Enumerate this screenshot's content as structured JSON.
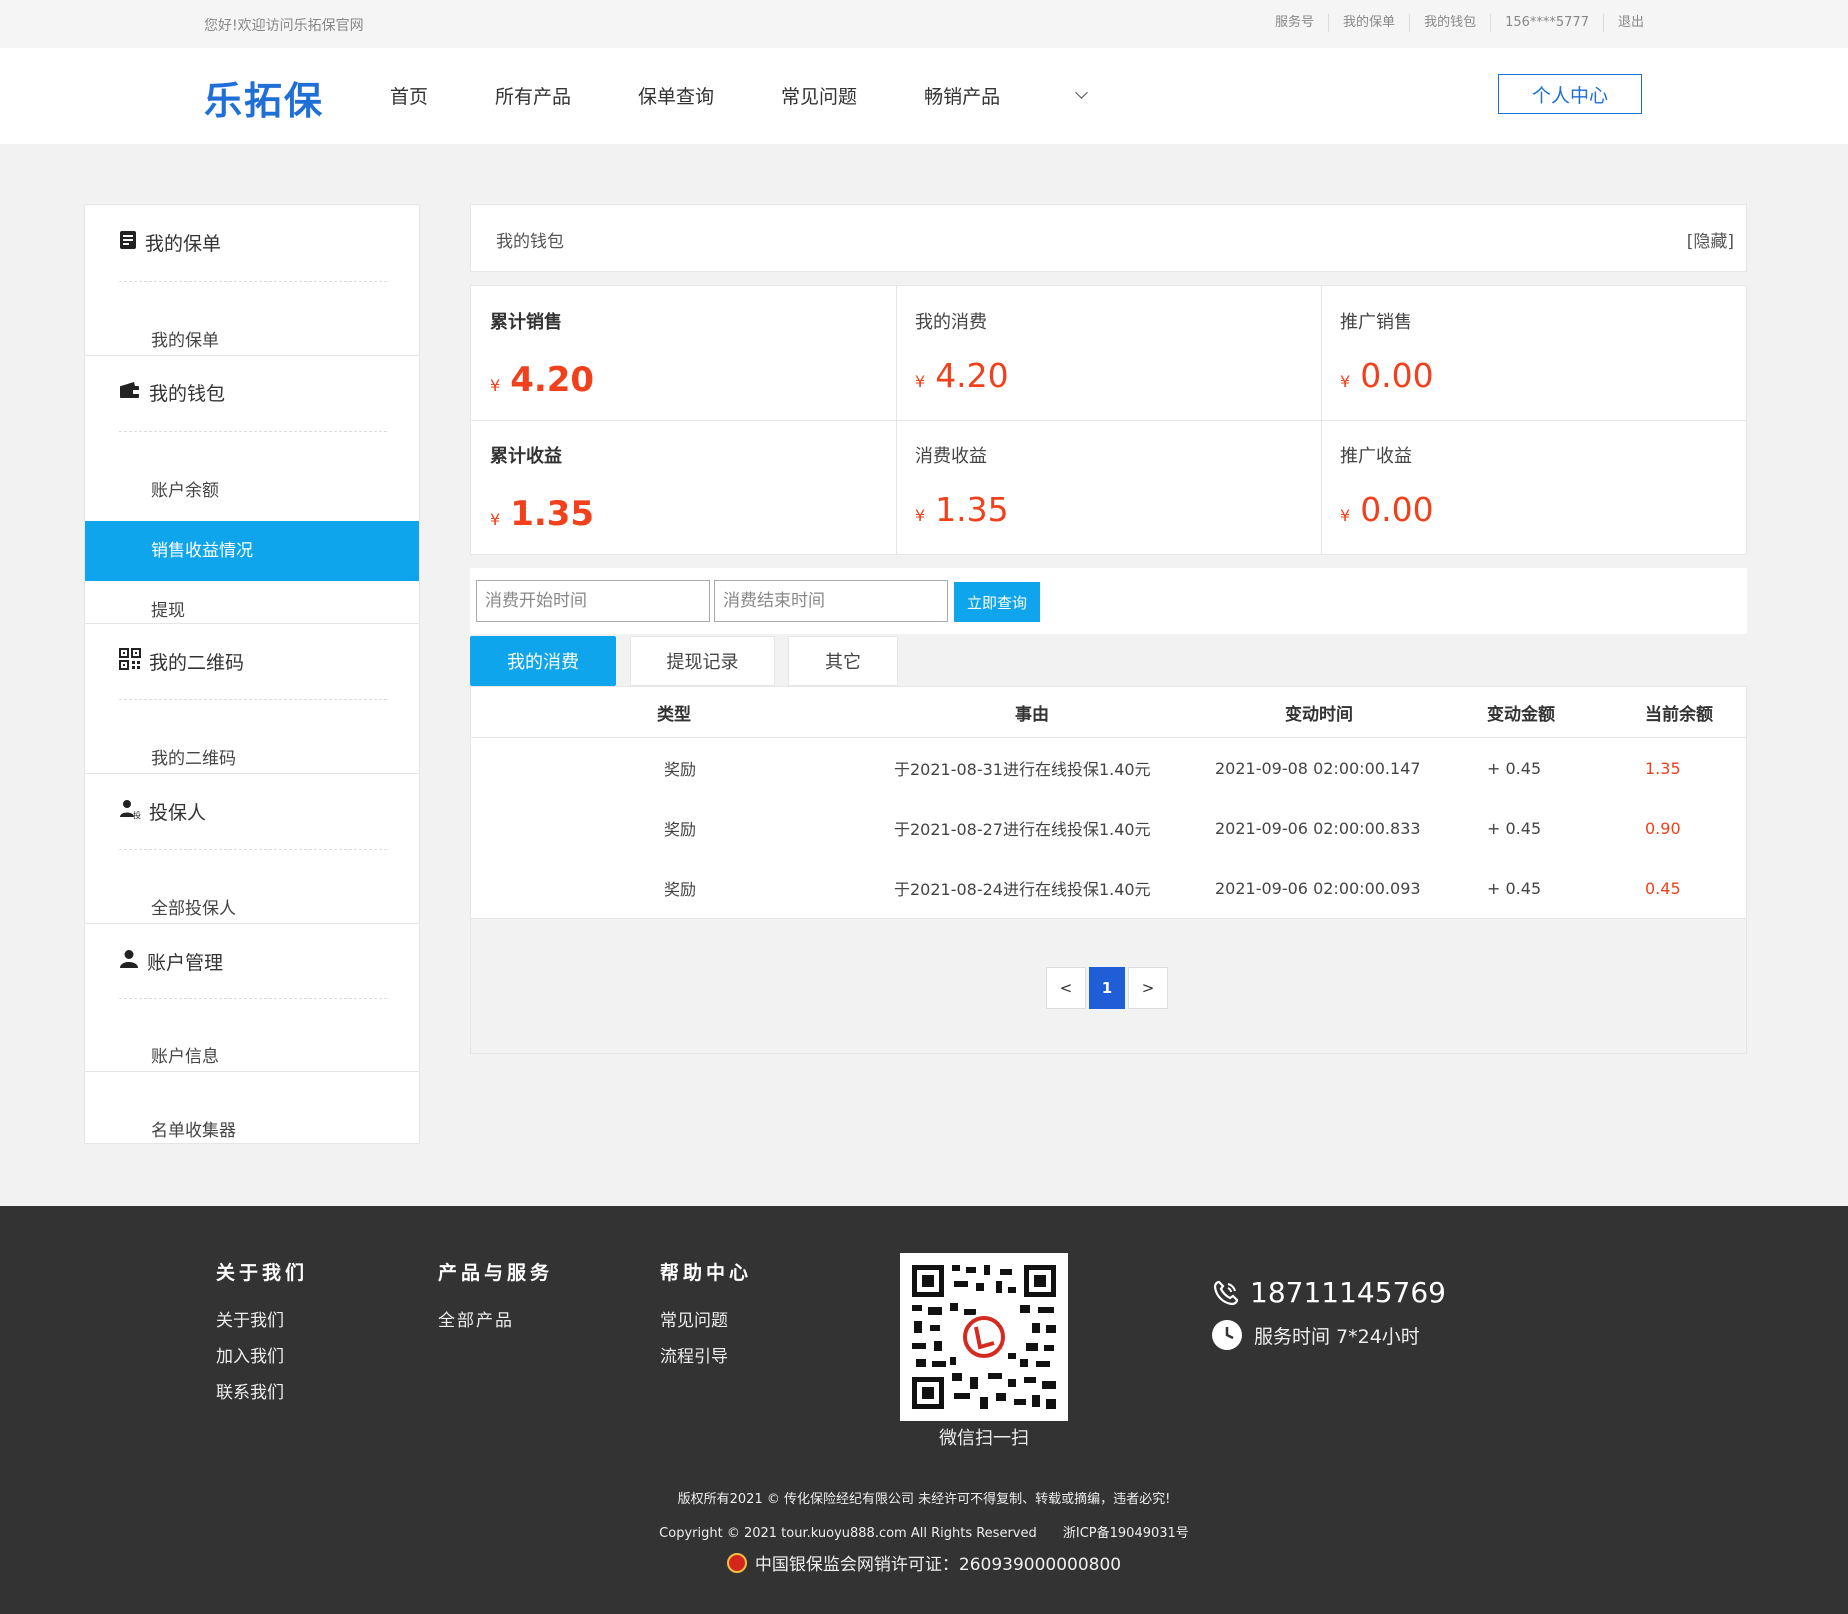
{
  "topbar": {
    "greeting": "您好!欢迎访问乐拓保官网",
    "links": [
      "服务号",
      "我的保单",
      "我的钱包",
      "156****5777",
      "退出"
    ]
  },
  "header": {
    "logo": "乐拓保",
    "nav": [
      "首页",
      "所有产品",
      "保单查询",
      "常见问题",
      "畅销产品"
    ],
    "personal_center": "个人中心"
  },
  "sidebar": {
    "sections": [
      {
        "title": "我的保单",
        "icon": "policy-icon",
        "items": [
          "我的保单"
        ]
      },
      {
        "title": "我的钱包",
        "icon": "wallet-icon",
        "items": [
          "账户余额",
          "销售收益情况",
          "提现"
        ]
      },
      {
        "title": "我的二维码",
        "icon": "qrcode-icon",
        "items": [
          "我的二维码"
        ]
      },
      {
        "title": "投保人",
        "icon": "insured-user-icon",
        "items": [
          "全部投保人"
        ]
      },
      {
        "title": "账户管理",
        "icon": "user-icon",
        "items": [
          "账户信息"
        ]
      }
    ],
    "extra_item": "名单收集器",
    "active_item": "销售收益情况"
  },
  "wallet": {
    "title": "我的钱包",
    "hide_label": "[隐藏]"
  },
  "stats": {
    "currency": "¥",
    "cells": [
      {
        "label": "累计销售",
        "value": "4.20"
      },
      {
        "label": "我的消费",
        "value": "4.20"
      },
      {
        "label": "推广销售",
        "value": "0.00"
      },
      {
        "label": "累计收益",
        "value": "1.35"
      },
      {
        "label": "消费收益",
        "value": "1.35"
      },
      {
        "label": "推广收益",
        "value": "0.00"
      }
    ]
  },
  "filter": {
    "start_placeholder": "消费开始时间",
    "end_placeholder": "消费结束时间",
    "query_button": "立即查询"
  },
  "tabs": [
    "我的消费",
    "提现记录",
    "其它"
  ],
  "table": {
    "headers": [
      "类型",
      "事由",
      "变动时间",
      "变动金额",
      "当前余额"
    ],
    "rows": [
      {
        "type": "奖励",
        "reason": "于2021-08-31进行在线投保1.40元",
        "time": "2021-09-08 02:00:00.147",
        "amount": "+ 0.45",
        "balance": "1.35"
      },
      {
        "type": "奖励",
        "reason": "于2021-08-27进行在线投保1.40元",
        "time": "2021-09-06 02:00:00.833",
        "amount": "+ 0.45",
        "balance": "0.90"
      },
      {
        "type": "奖励",
        "reason": "于2021-08-24进行在线投保1.40元",
        "time": "2021-09-06 02:00:00.093",
        "amount": "+ 0.45",
        "balance": "0.45"
      }
    ]
  },
  "pager": {
    "prev": "<",
    "current": "1",
    "next": ">"
  },
  "footer": {
    "cols": [
      {
        "title": "关于我们",
        "links": [
          "关于我们",
          "加入我们",
          "联系我们"
        ]
      },
      {
        "title": "产品与服务",
        "links": [
          "全部产品"
        ]
      },
      {
        "title": "帮助中心",
        "links": [
          "常见问题",
          "流程引导"
        ]
      }
    ],
    "qr_caption": "微信扫一扫",
    "phone": "18711145769",
    "service_time": "服务时间 7*24小时",
    "copyright": "版权所有2021 © 传化保险经纪有限公司 未经许可不得复制、转载或摘编，违者必究!",
    "copyright_en": "Copyright © 2021 tour.kuoyu888.com All Rights Reserved",
    "icp": "浙ICP备19049031号",
    "license": "中国银保监会网销许可证：260939000000800"
  },
  "colors": {
    "brand": "#1f6fd6",
    "accent": "#0fa5ec",
    "money": "#f0401c",
    "footer_bg": "#333333"
  }
}
